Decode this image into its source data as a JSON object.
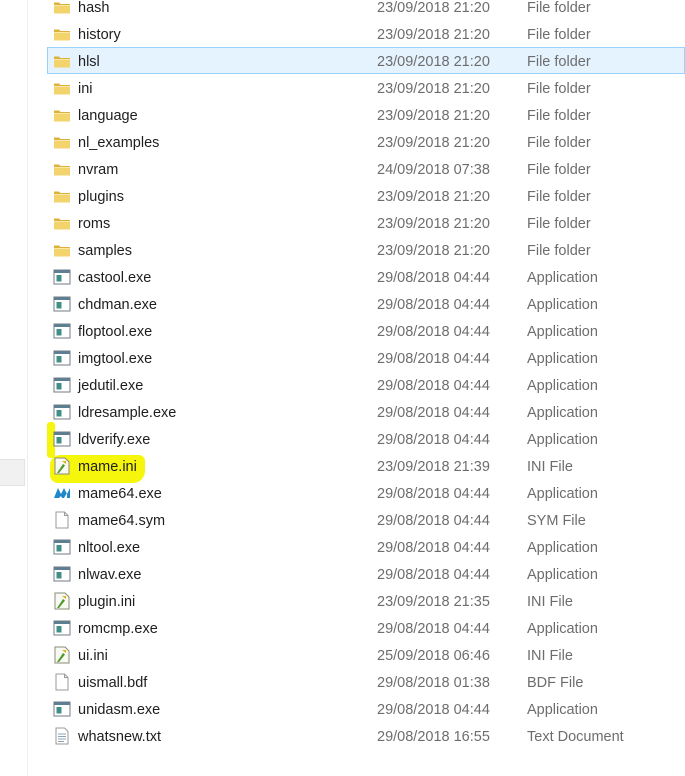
{
  "files": [
    {
      "name": "hash",
      "date": "23/09/2018 21:20",
      "type": "File folder",
      "icon": "folder-icon",
      "selected": false
    },
    {
      "name": "history",
      "date": "23/09/2018 21:20",
      "type": "File folder",
      "icon": "folder-icon",
      "selected": false
    },
    {
      "name": "hlsl",
      "date": "23/09/2018 21:20",
      "type": "File folder",
      "icon": "folder-icon",
      "selected": true
    },
    {
      "name": "ini",
      "date": "23/09/2018 21:20",
      "type": "File folder",
      "icon": "folder-icon",
      "selected": false
    },
    {
      "name": "language",
      "date": "23/09/2018 21:20",
      "type": "File folder",
      "icon": "folder-icon",
      "selected": false
    },
    {
      "name": "nl_examples",
      "date": "23/09/2018 21:20",
      "type": "File folder",
      "icon": "folder-icon",
      "selected": false
    },
    {
      "name": "nvram",
      "date": "24/09/2018 07:38",
      "type": "File folder",
      "icon": "folder-icon",
      "selected": false
    },
    {
      "name": "plugins",
      "date": "23/09/2018 21:20",
      "type": "File folder",
      "icon": "folder-icon",
      "selected": false
    },
    {
      "name": "roms",
      "date": "23/09/2018 21:20",
      "type": "File folder",
      "icon": "folder-icon",
      "selected": false
    },
    {
      "name": "samples",
      "date": "23/09/2018 21:20",
      "type": "File folder",
      "icon": "folder-icon",
      "selected": false
    },
    {
      "name": "castool.exe",
      "date": "29/08/2018 04:44",
      "type": "Application",
      "icon": "application-icon",
      "selected": false
    },
    {
      "name": "chdman.exe",
      "date": "29/08/2018 04:44",
      "type": "Application",
      "icon": "application-icon",
      "selected": false
    },
    {
      "name": "floptool.exe",
      "date": "29/08/2018 04:44",
      "type": "Application",
      "icon": "application-icon",
      "selected": false
    },
    {
      "name": "imgtool.exe",
      "date": "29/08/2018 04:44",
      "type": "Application",
      "icon": "application-icon",
      "selected": false
    },
    {
      "name": "jedutil.exe",
      "date": "29/08/2018 04:44",
      "type": "Application",
      "icon": "application-icon",
      "selected": false
    },
    {
      "name": "ldresample.exe",
      "date": "29/08/2018 04:44",
      "type": "Application",
      "icon": "application-icon",
      "selected": false
    },
    {
      "name": "ldverify.exe",
      "date": "29/08/2018 04:44",
      "type": "Application",
      "icon": "application-icon",
      "selected": false
    },
    {
      "name": "mame.ini",
      "date": "23/09/2018 21:39",
      "type": "INI File",
      "icon": "ini-file-icon",
      "selected": false
    },
    {
      "name": "mame64.exe",
      "date": "29/08/2018 04:44",
      "type": "Application",
      "icon": "mame-logo-icon",
      "selected": false
    },
    {
      "name": "mame64.sym",
      "date": "29/08/2018 04:44",
      "type": "SYM File",
      "icon": "blank-file-icon",
      "selected": false
    },
    {
      "name": "nltool.exe",
      "date": "29/08/2018 04:44",
      "type": "Application",
      "icon": "application-icon",
      "selected": false
    },
    {
      "name": "nlwav.exe",
      "date": "29/08/2018 04:44",
      "type": "Application",
      "icon": "application-icon",
      "selected": false
    },
    {
      "name": "plugin.ini",
      "date": "23/09/2018 21:35",
      "type": "INI File",
      "icon": "ini-file-icon",
      "selected": false
    },
    {
      "name": "romcmp.exe",
      "date": "29/08/2018 04:44",
      "type": "Application",
      "icon": "application-icon",
      "selected": false
    },
    {
      "name": "ui.ini",
      "date": "25/09/2018 06:46",
      "type": "INI File",
      "icon": "ini-file-icon",
      "selected": false
    },
    {
      "name": "uismall.bdf",
      "date": "29/08/2018 01:38",
      "type": "BDF File",
      "icon": "blank-file-icon",
      "selected": false
    },
    {
      "name": "unidasm.exe",
      "date": "29/08/2018 04:44",
      "type": "Application",
      "icon": "application-icon",
      "selected": false
    },
    {
      "name": "whatsnew.txt",
      "date": "29/08/2018 16:55",
      "type": "Text Document",
      "icon": "text-file-icon",
      "selected": false
    }
  ],
  "highlight_color": "#f6f600",
  "selection_color": "#e5f3ff",
  "folder_color": "#e8c24f"
}
